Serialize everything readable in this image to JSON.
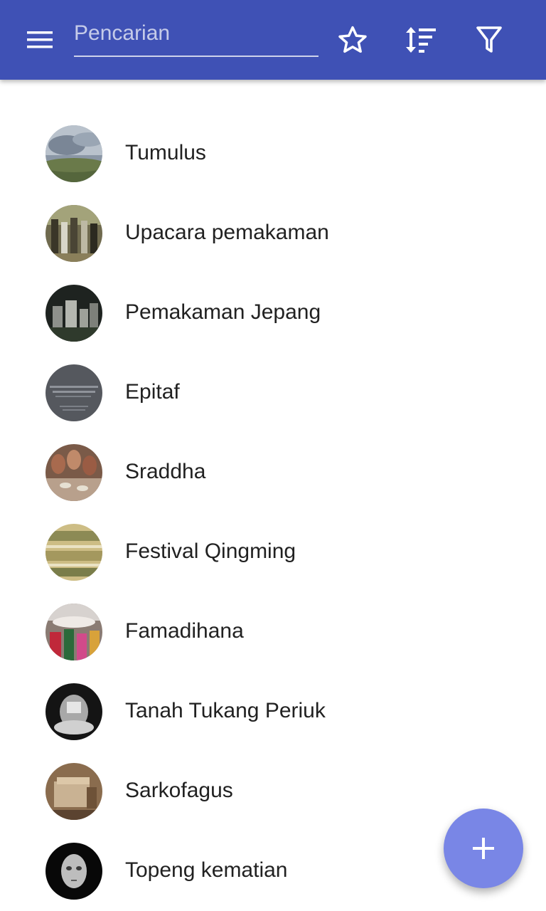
{
  "appbar": {
    "background": "#3f51b5",
    "menu_icon": "menu-icon",
    "search": {
      "placeholder": "Pencarian",
      "value": ""
    },
    "actions": [
      {
        "name": "favorites",
        "icon": "star-outline-icon"
      },
      {
        "name": "sort",
        "icon": "sort-icon"
      },
      {
        "name": "filter",
        "icon": "filter-icon"
      }
    ]
  },
  "items": [
    {
      "label": "Tumulus"
    },
    {
      "label": "Upacara pemakaman"
    },
    {
      "label": "Pemakaman Jepang"
    },
    {
      "label": "Epitaf"
    },
    {
      "label": "Sraddha"
    },
    {
      "label": "Festival Qingming"
    },
    {
      "label": "Famadihana"
    },
    {
      "label": "Tanah Tukang Periuk"
    },
    {
      "label": "Sarkofagus"
    },
    {
      "label": "Topeng kematian"
    }
  ],
  "fab": {
    "icon": "plus-icon",
    "color": "#7986e6"
  }
}
